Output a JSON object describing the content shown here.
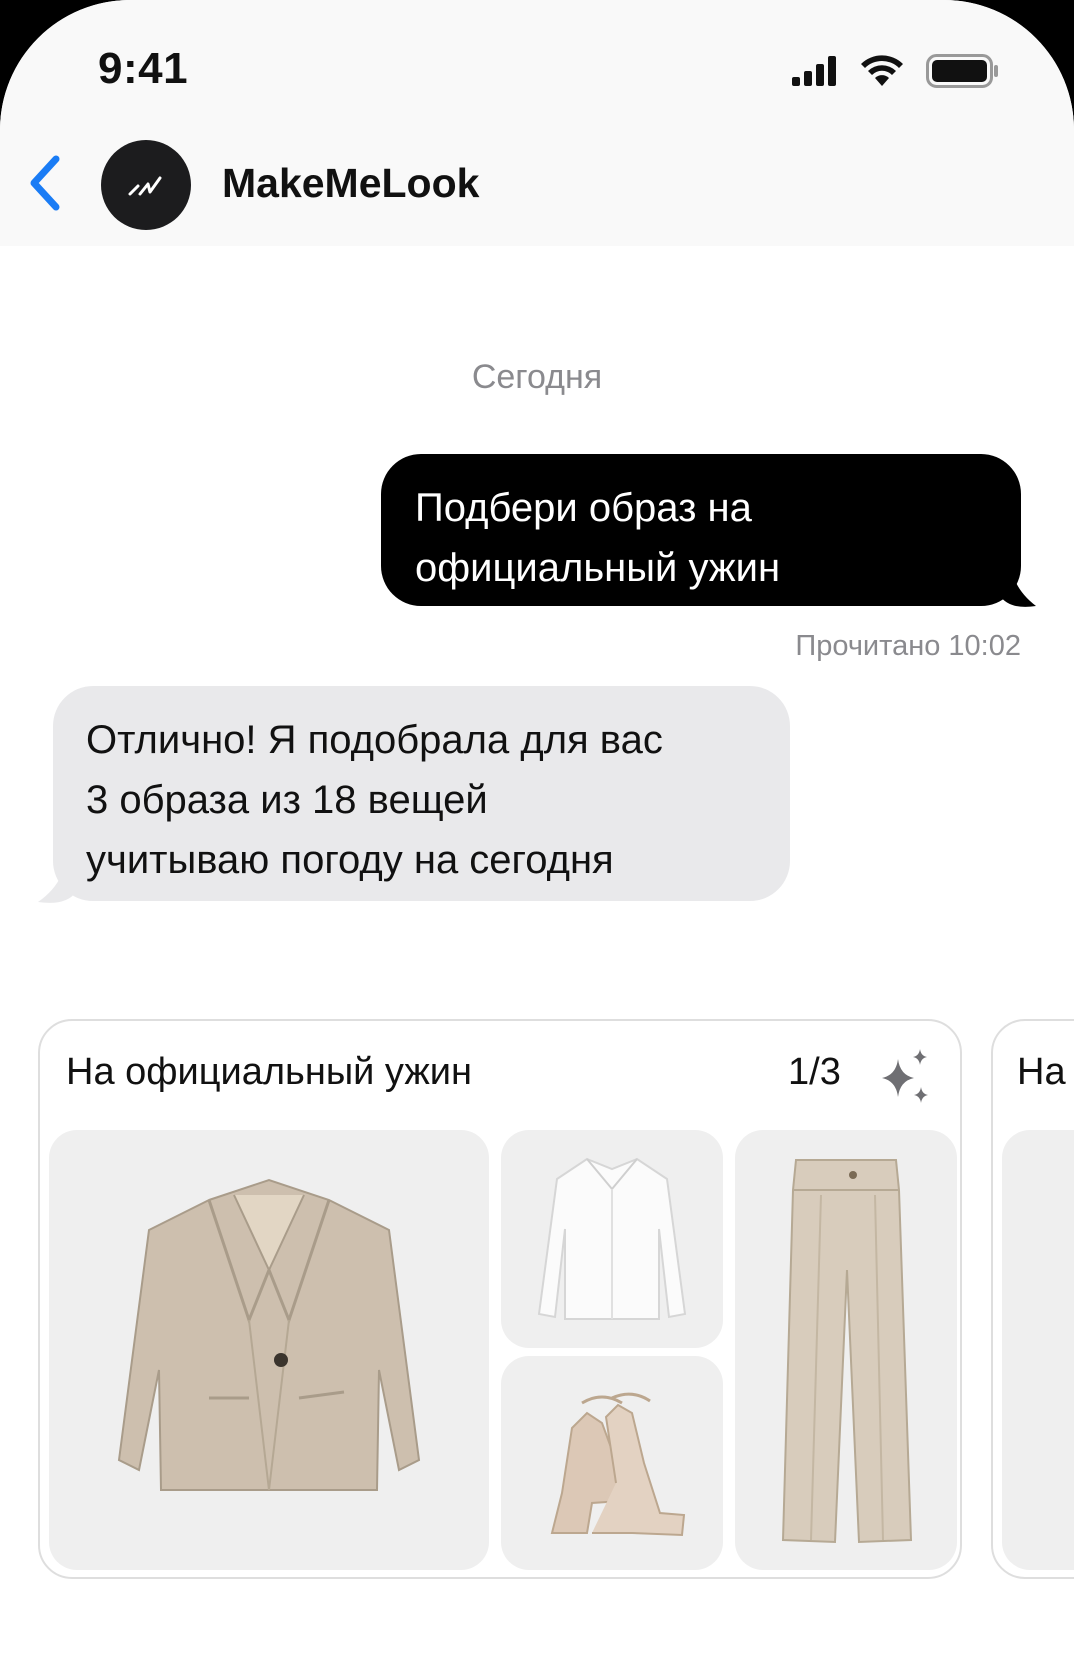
{
  "status_bar": {
    "time": "9:41"
  },
  "header": {
    "contact_name": "MakeMeLook"
  },
  "chat": {
    "date_separator": "Сегодня",
    "outgoing": {
      "line1": "Подбери образ на",
      "line2": "официальный ужин",
      "receipt": "Прочитано 10:02"
    },
    "incoming": {
      "line1": "Отлично! Я подобрала для вас",
      "line2": "3 образа из 18 вещей",
      "line3": "учитываю погоду на сегодня"
    }
  },
  "outfits": [
    {
      "title": "На официальный ужин",
      "counter": "1/3",
      "items": [
        "blazer",
        "shirt",
        "heels",
        "trousers"
      ]
    },
    {
      "title": "На"
    }
  ],
  "colors": {
    "accent_blue": "#1a7cf5",
    "outgoing_bubble": "#000000",
    "incoming_bubble": "#e9e9eb",
    "beige": "#cdbfae"
  }
}
